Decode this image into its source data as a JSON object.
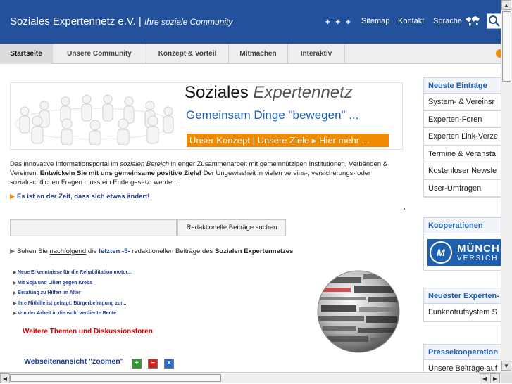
{
  "header": {
    "brand": "Soziales Expertennetz e.V. |",
    "tagline": "Ihre soziale Community",
    "plus": "+ + +",
    "links": [
      "Sitemap",
      "Kontakt",
      "Sprache"
    ],
    "colors": {
      "header_bg": "#24519c",
      "accent": "#f08a00",
      "link": "#1f3f8f"
    }
  },
  "nav": {
    "tabs": [
      "Startseite",
      "Unsere Community",
      "Konzept & Vorteil",
      "Mitmachen",
      "Interaktiv"
    ],
    "active": "Startseite"
  },
  "banner": {
    "title_a": "Soziales",
    "title_b": "Expertennetz",
    "subtitle": "Gemeinsam Dinge \"bewegen\" ...",
    "button": "Unser Konzept | Unsere Ziele ▸ Hier mehr ..."
  },
  "intro": {
    "p1": "Das innovative Informationsportal im ",
    "p1_italic": "sozialen Bereich",
    "p2": " in enger Zusammenarbeit mit gemeinnützigen Institutionen, Verbänden & Vereinen. ",
    "p2_bold": "Entwickeln Sie mit uns gemeinsame positive Ziele!",
    "p3": " Der Ungewissheit in vielen vereins-, versicherungs- oder sozialrechtlichen Fragen muss ein Ende gesetzt werden.",
    "cta": "Es ist an der Zeit, dass sich etwas ändert!"
  },
  "search": {
    "placeholder": "",
    "button": "Redaktionelle Beiträge suchen"
  },
  "latest": {
    "a": "Sehen Sie ",
    "link": "nachfolgend",
    "b": " die ",
    "bold1": "letzten -5-",
    "c": " redaktionellen Beiträge des ",
    "bold2": "Sozialen Expertennetzes"
  },
  "articles": [
    "Neue Erkenntnisse für die Rehabilitation motor...",
    "Mit Soja und Lilien gegen Krebs",
    "Beratung zu Hilfen im Alter",
    "Ihre Mithilfe ist gefragt: Bürgerbefragung zur...",
    "Von der Arbeit in die wohl verdiente Rente"
  ],
  "more_link": "Weitere Themen und Diskussionsforen",
  "zoom_label": "Webseitenansicht \"zoomen\"",
  "sidebar": {
    "news_title": "Neuste Einträge",
    "news_items": [
      "System- & Vereinsr",
      "Experten-Foren",
      "Experten Link-Verze",
      "Termine & Veransta",
      "Kostenloser Newsle",
      "User-Umfragen"
    ],
    "coop_title": "Kooperationen",
    "coop_logo_mark": "M",
    "coop_logo_text": "MÜNCH",
    "coop_logo_text2": "VERSICH",
    "expert_title": "Neuester Experten-",
    "expert_item": "Funknotrufsystem S",
    "press_title": "Pressekooperation",
    "press_item": "Unsere Beiträge auf"
  }
}
